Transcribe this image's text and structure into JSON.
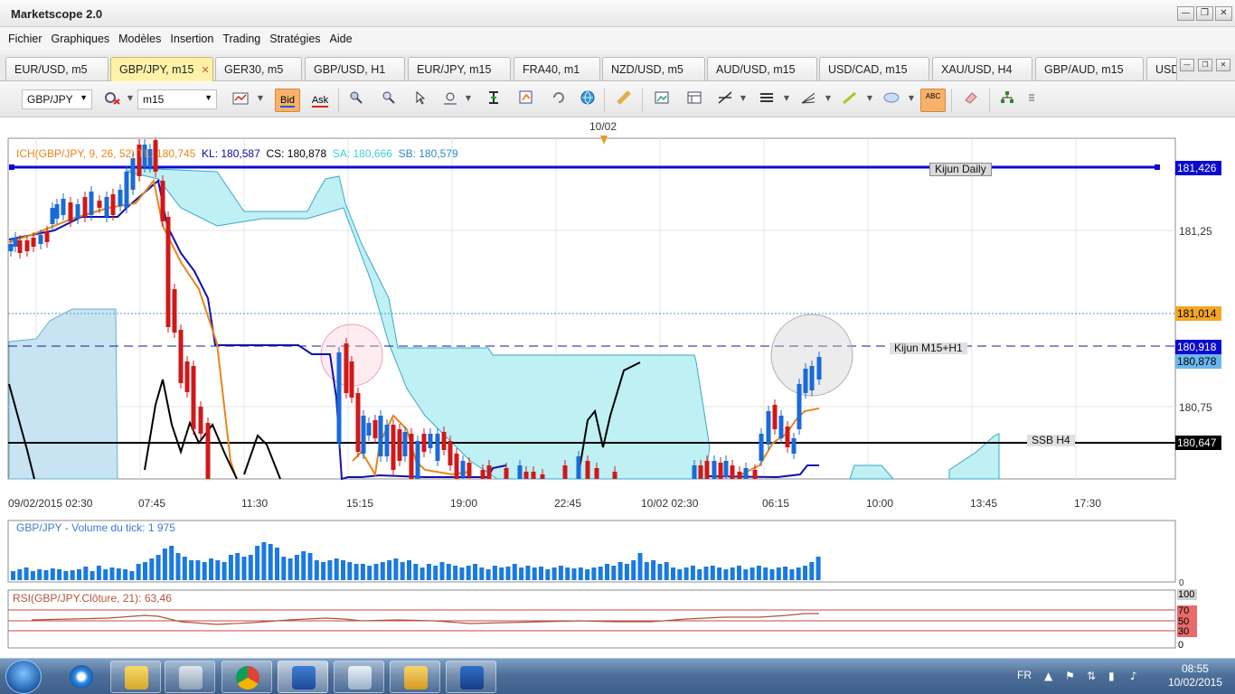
{
  "window": {
    "title": "Marketscope 2.0",
    "minimize_icon": "minimize-icon",
    "restore_icon": "restore-icon",
    "close_icon": "close-icon",
    "minimize_glyph": "—",
    "restore_glyph": "❐",
    "close_glyph": "✕"
  },
  "menu": [
    "Fichier",
    "Graphiques",
    "Modèles",
    "Insertion",
    "Trading",
    "Stratégies",
    "Aide"
  ],
  "tabs": [
    {
      "label": "EUR/USD, m5",
      "active": false
    },
    {
      "label": "GBP/JPY, m15",
      "active": true
    },
    {
      "label": "GER30, m5",
      "active": false
    },
    {
      "label": "GBP/USD, H1",
      "active": false
    },
    {
      "label": "EUR/JPY, m15",
      "active": false
    },
    {
      "label": "FRA40, m1",
      "active": false
    },
    {
      "label": "NZD/USD, m5",
      "active": false
    },
    {
      "label": "AUD/USD, m15",
      "active": false
    },
    {
      "label": "USD/CAD, m15",
      "active": false
    },
    {
      "label": "XAU/USD, H4",
      "active": false
    },
    {
      "label": "GBP/AUD, m15",
      "active": false
    },
    {
      "label": "USD",
      "active": false
    }
  ],
  "toolbar": {
    "instrument": "GBP/JPY",
    "timeframe": "m15",
    "bid_label": "Bid",
    "ask_label": "Ask",
    "abc_label": "ABC",
    "icons": [
      "chart-style-icon",
      "bid-icon",
      "ask-icon",
      "zoom-in-icon",
      "zoom-out-icon",
      "cursor-icon",
      "magnifier-icon",
      "crosshair-icon",
      "indicators-icon",
      "refresh-icon",
      "globe-icon",
      "ruler-icon",
      "snapshot-icon",
      "layout-icon",
      "trendline-icon",
      "horizontal-lines-icon",
      "fan-icon",
      "pen-icon",
      "ellipse-icon",
      "text-icon",
      "eraser-icon",
      "tree-icon",
      "more-icon"
    ]
  },
  "chart": {
    "accent": "#0a0ad0",
    "top_date_marker": "10/02",
    "indicator_label": {
      "name": "ICH(GBP/JPY, 9, 26, 52)",
      "tl": "TL: 180,745",
      "kl": "KL: 180,587",
      "cs": "CS: 180,878",
      "sa": "SA: 180,666",
      "sb": "SB: 180,579"
    },
    "annotations": {
      "kijun_daily": "Kijun Daily",
      "kijun_m15": "Kijun M15+H1",
      "ssb_h4": "SSB H4"
    },
    "price_axis": {
      "ticks": [
        "181,25",
        "180,75"
      ],
      "tags": [
        {
          "text": "181,426",
          "bg": "#0a0ad0",
          "fg": "#ffffff"
        },
        {
          "text": "181,014",
          "bg": "#f5a623",
          "fg": "#000000"
        },
        {
          "text": "180,918",
          "bg": "#0a0ad0",
          "fg": "#ffffff"
        },
        {
          "text": "180,878",
          "bg": "#6ab8f0",
          "fg": "#000000"
        },
        {
          "text": "180,647",
          "bg": "#000000",
          "fg": "#ffffff"
        }
      ]
    },
    "time_axis": [
      "09/02/2015 02:30",
      "07:45",
      "11:30",
      "15:15",
      "19:00",
      "22:45",
      "10/02 02:30",
      "06:15",
      "10:00",
      "13:45",
      "17:30"
    ]
  },
  "volume": {
    "label": "GBP/JPY - Volume du tick: 1 975",
    "axis_zero": "0"
  },
  "rsi": {
    "label": "RSI(GBP/JPY.Clôture, 21): 63,46",
    "levels": [
      "100",
      "70",
      "50",
      "30",
      "0"
    ]
  },
  "chart_data": {
    "type": "candlestick",
    "instrument": "GBP/JPY",
    "timeframe": "m15",
    "ylim": [
      180.5,
      181.55
    ],
    "horizontal_lines": [
      {
        "label": "Kijun Daily",
        "value": 181.426
      },
      {
        "label": "Kijun M15+H1",
        "value": 180.918
      },
      {
        "label": "SSB H4",
        "value": 180.647
      },
      {
        "label": "",
        "value": 181.014
      }
    ],
    "last_price": 180.878,
    "volume_last": 1975,
    "rsi_last": 63.46
  },
  "taskbar": {
    "language": "FR",
    "time": "08:55",
    "date": "10/02/2015",
    "apps": [
      "internet-explorer-icon",
      "file-explorer-icon",
      "calculator-icon",
      "chrome-icon",
      "marketscope-icon",
      "contacts-icon",
      "outlook-icon",
      "trading-station-icon"
    ]
  }
}
